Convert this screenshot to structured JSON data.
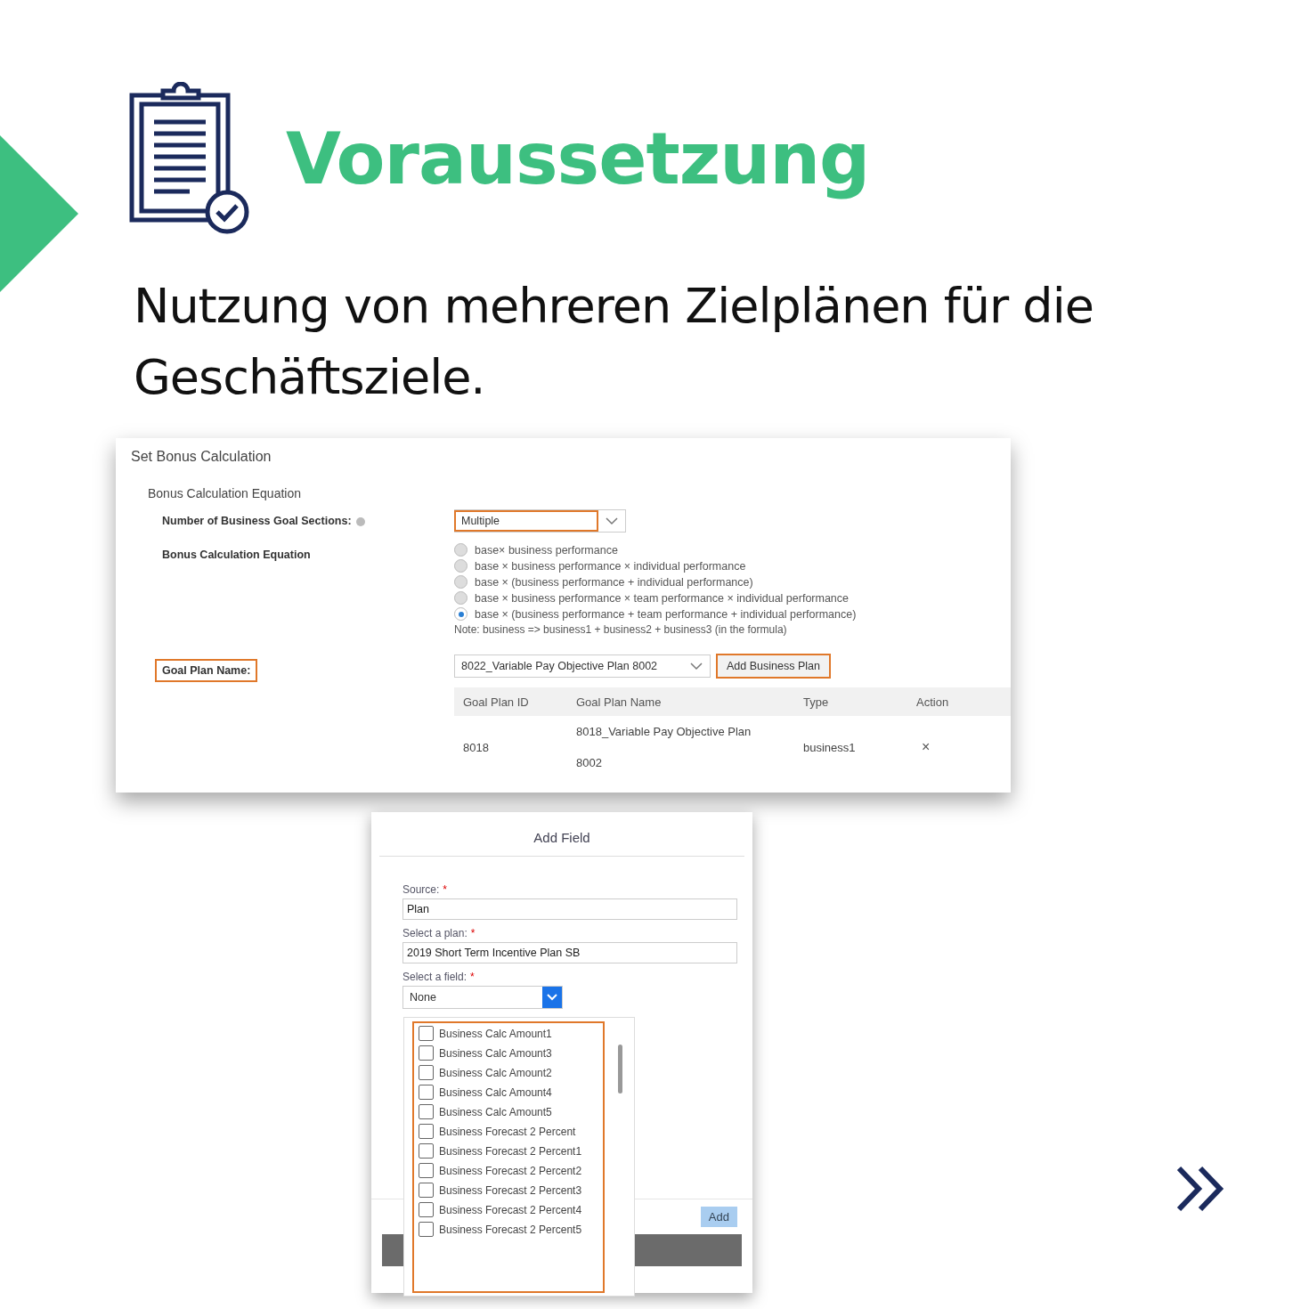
{
  "heading": {
    "title": "Voraussetzung",
    "subtitle": "Nutzung von mehreren Zielplänen für die Geschäftsziele."
  },
  "bonus_panel": {
    "title": "Set Bonus Calculation",
    "section": "Bonus Calculation Equation",
    "sections_field": {
      "label": "Number of Business Goal Sections:",
      "value": "Multiple",
      "highlighted": true
    },
    "equation": {
      "label": "Bonus Calculation Equation",
      "options": [
        {
          "label": "base× business performance",
          "selected": false
        },
        {
          "label": "base × business performance × individual performance",
          "selected": false
        },
        {
          "label": "base × (business performance + individual performance)",
          "selected": false
        },
        {
          "label": "base × business performance × team performance × individual performance",
          "selected": false
        },
        {
          "label": "base × (business performance + team performance + individual performance)",
          "selected": true
        }
      ],
      "note": "Note: business => business1 + business2 + business3 (in the formula)"
    },
    "goal_plan": {
      "label": "Goal Plan Name:",
      "label_highlighted": true,
      "value": "8022_Variable Pay Objective Plan 8002",
      "button": "Add Business Plan",
      "button_highlighted": true
    },
    "table": {
      "columns": [
        "Goal Plan ID",
        "Goal Plan Name",
        "Type",
        "Action"
      ],
      "rows": [
        {
          "id": "8018",
          "name_lines": [
            "8018_Variable Pay Objective Plan",
            "8002"
          ],
          "type": "business1",
          "action": "×"
        }
      ]
    }
  },
  "add_field_dialog": {
    "title": "Add Field",
    "fields": [
      {
        "label": "Source:",
        "required_mark": "*",
        "value": "Plan"
      },
      {
        "label": "Select a plan:",
        "required_mark": "*",
        "value": "2019 Short Term Incentive Plan SB"
      }
    ],
    "select": {
      "label": "Select a field:",
      "required_mark": "*",
      "value": "None"
    },
    "list_highlighted": true,
    "options": [
      {
        "label": "Business Calc Amount1",
        "checked": false
      },
      {
        "label": "Business Calc Amount3",
        "checked": false
      },
      {
        "label": "Business Calc Amount2",
        "checked": false
      },
      {
        "label": "Business Calc Amount4",
        "checked": false
      },
      {
        "label": "Business Calc Amount5",
        "checked": false
      },
      {
        "label": "Business Forecast 2 Percent",
        "checked": false
      },
      {
        "label": "Business Forecast 2 Percent1",
        "checked": false
      },
      {
        "label": "Business Forecast 2 Percent2",
        "checked": false
      },
      {
        "label": "Business Forecast 2 Percent3",
        "checked": false
      },
      {
        "label": "Business Forecast 2 Percent4",
        "checked": false
      },
      {
        "label": "Business Forecast 2 Percent5",
        "checked": false
      }
    ],
    "button": "Add"
  }
}
